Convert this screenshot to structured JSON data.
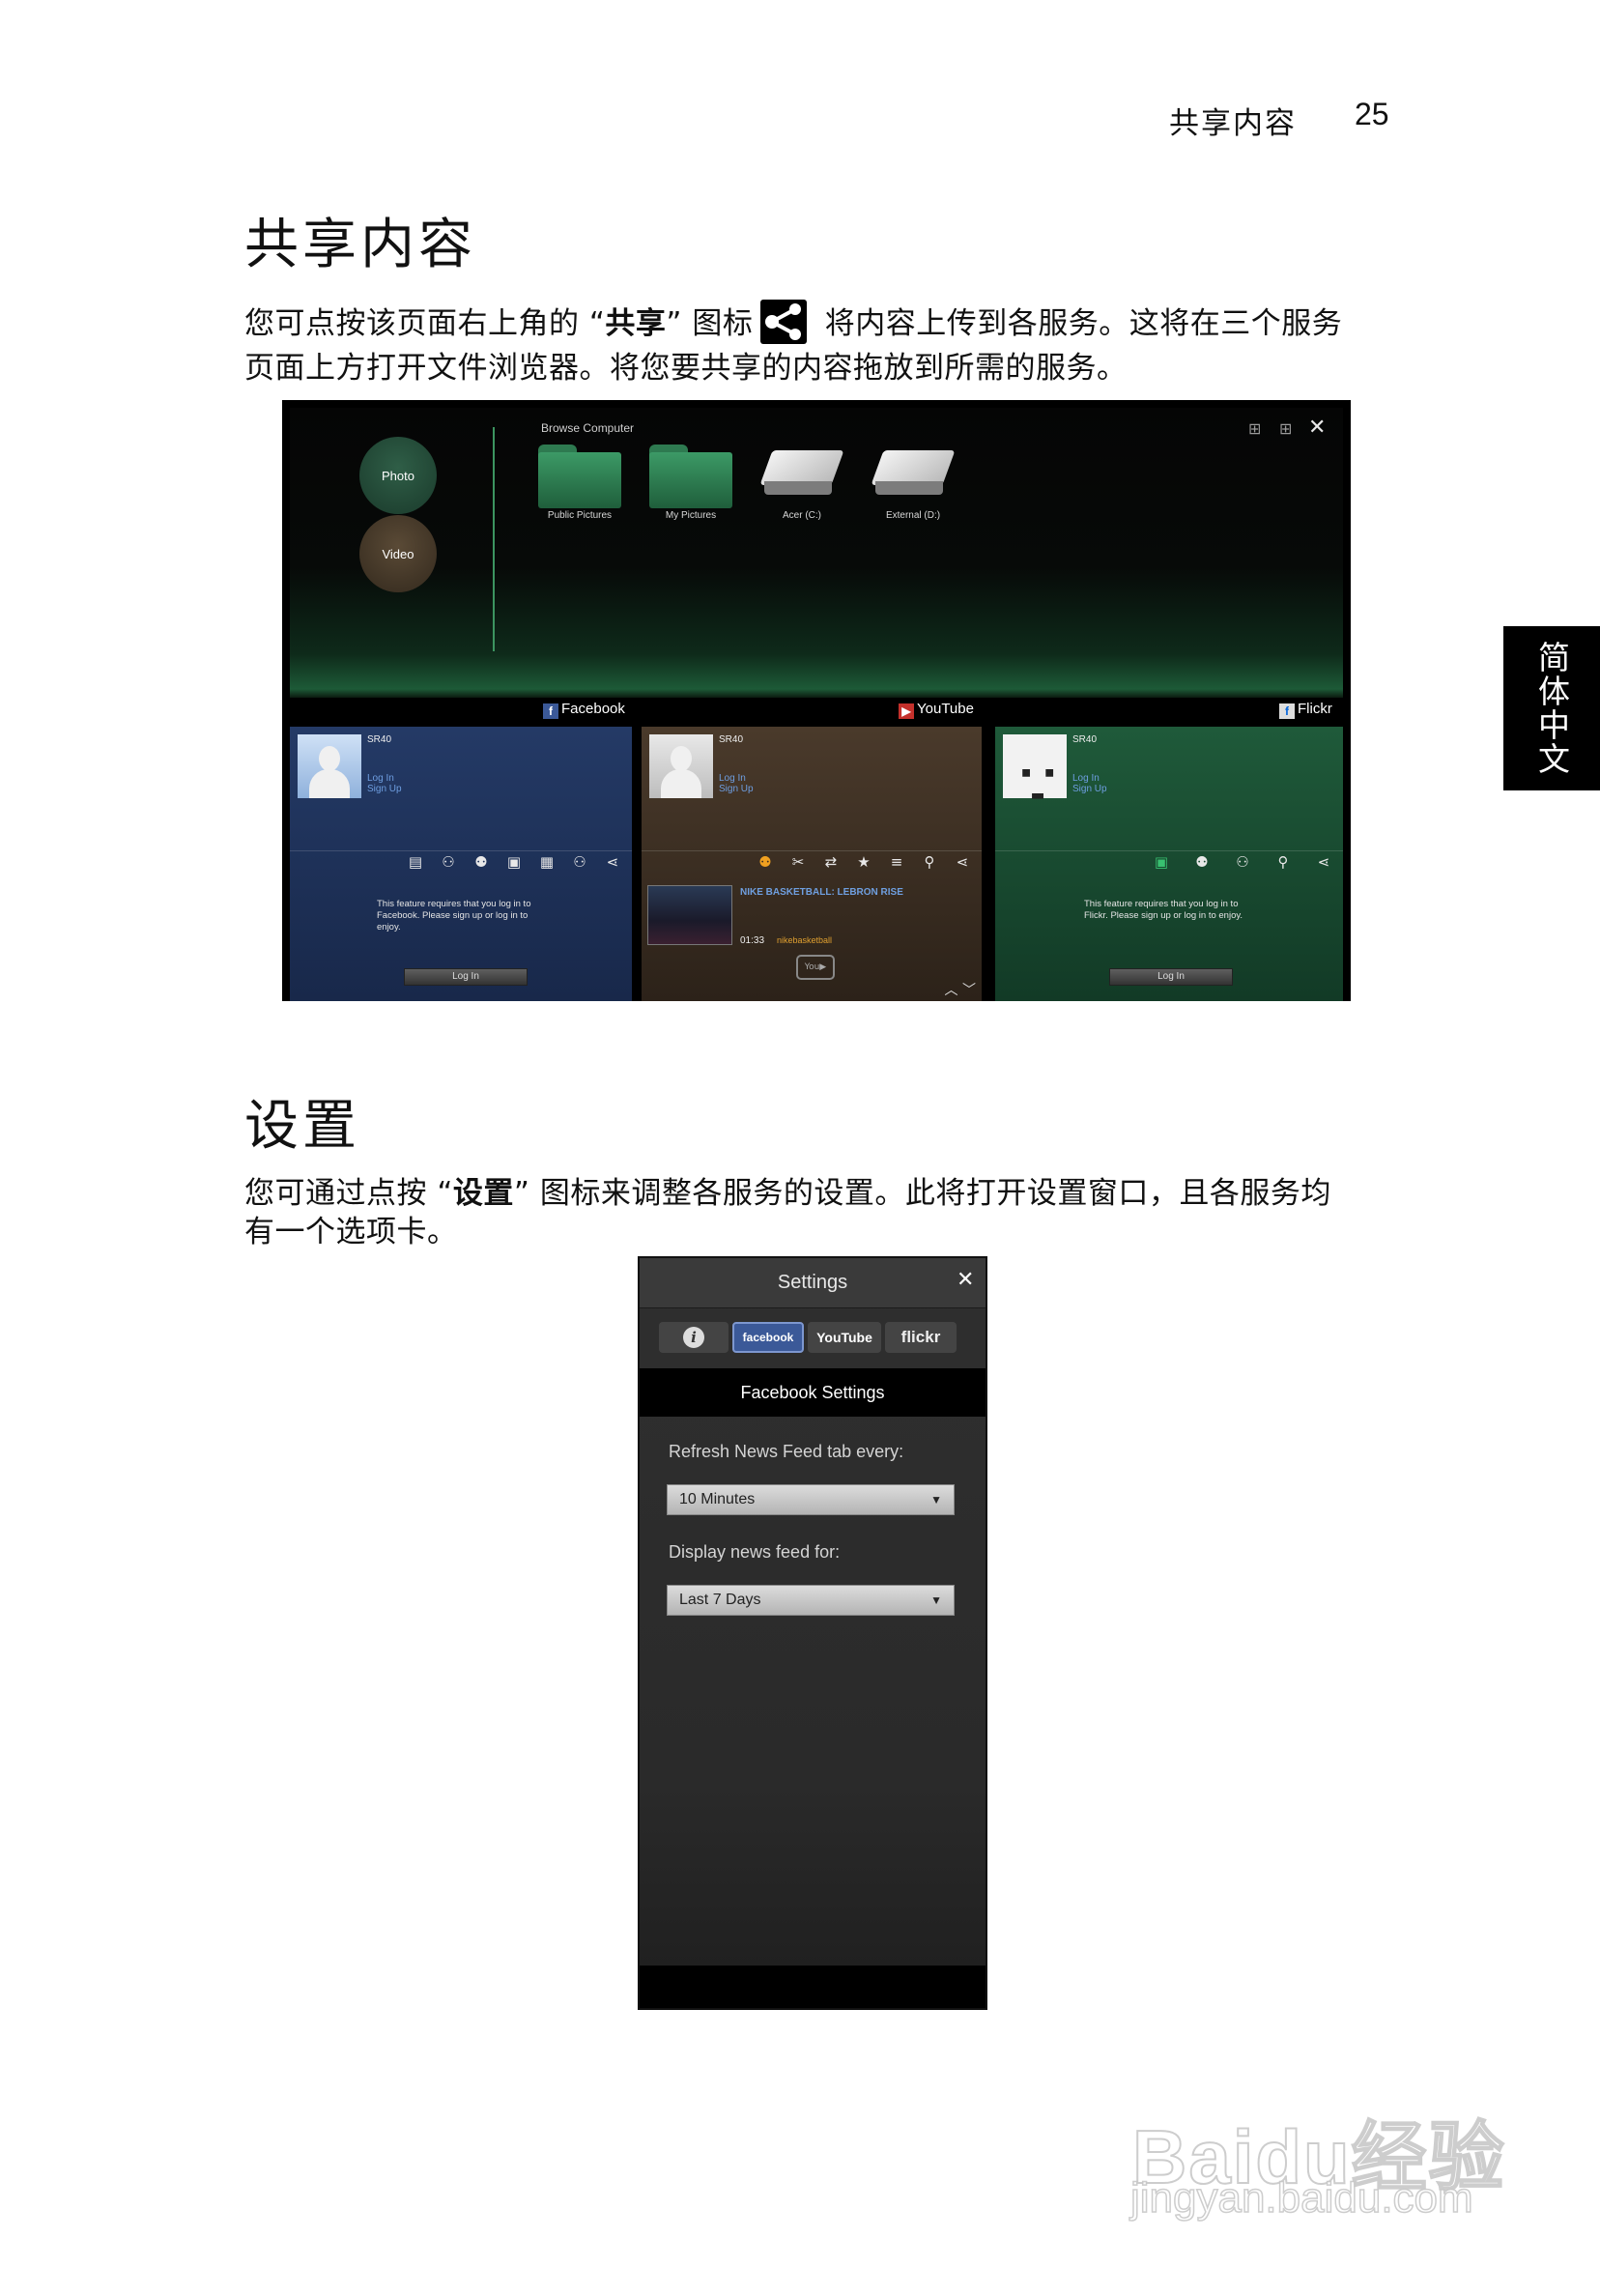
{
  "header": {
    "section": "共享内容",
    "page_number": "25"
  },
  "side_tab": {
    "label": "简体中文"
  },
  "share_section": {
    "heading": "共享内容",
    "para_line1_a": "您可点按该页面右上角的 “",
    "para_line1_bold": "共享",
    "para_line1_b": "” 图标",
    "para_line1_c": " 将内容上传到各服务。这将在三个服务",
    "para_line2": "页面上方打开文件浏览器。将您要共享的内容拖放到所需的服务。"
  },
  "app_screenshot": {
    "browse_title": "Browse Computer",
    "left_buttons": {
      "photo": "Photo",
      "video": "Video"
    },
    "tiles": [
      "Public Pictures",
      "My Pictures",
      "Acer (C:)",
      "External (D:)"
    ],
    "services": {
      "facebook": "Facebook",
      "youtube": "YouTube",
      "flickr": "Flickr"
    },
    "username": "SR40",
    "links": {
      "login": "Log In",
      "signup": "Sign Up"
    },
    "facebook_notice": "This feature requires that you log in to Facebook. Please sign up or log in to enjoy.",
    "flickr_notice": "This feature requires that you log in to Flickr. Please sign up or log in to enjoy.",
    "login_button": "Log In",
    "youtube_video": {
      "title": "NIKE BASKETBALL: LEBRON RISE",
      "duration": "01:33",
      "channel": "nikebasketball"
    }
  },
  "settings_section": {
    "heading": "设置",
    "para_line1_a": "您可通过点按 “",
    "para_line1_bold": "设置",
    "para_line1_b": "” 图标来调整各服务的设置。此将打开设置窗口，且各服务均",
    "para_line2": "有一个选项卡。"
  },
  "settings_dialog": {
    "title": "Settings",
    "tabs": {
      "info": "i",
      "facebook": "facebook",
      "youtube": "YouTube",
      "flickr": "flickr"
    },
    "section_title": "Facebook Settings",
    "refresh_label": "Refresh News Feed tab every:",
    "refresh_value": "10 Minutes",
    "display_label": "Display news feed for:",
    "display_value": "Last 7 Days"
  },
  "watermark": {
    "logo": "Baidu经验",
    "url": "jingyan.baidu.com"
  }
}
